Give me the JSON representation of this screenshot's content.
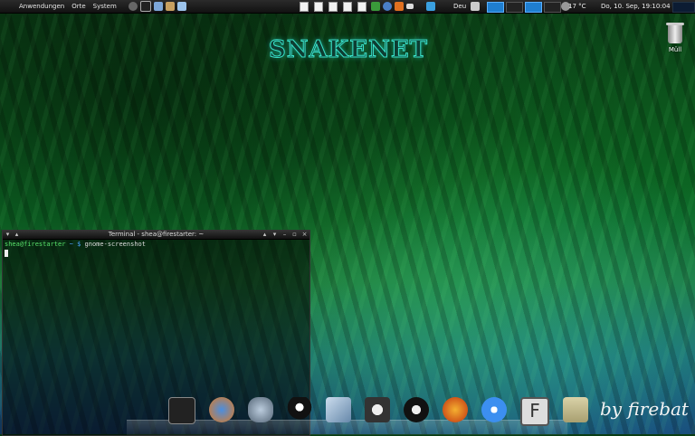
{
  "top_panel": {
    "menus": [
      "Anwendungen",
      "Orte",
      "System"
    ],
    "launchers": [
      "search-icon",
      "terminal-icon",
      "file-manager-icon",
      "tools-icon",
      "package-icon"
    ],
    "documents": [
      "document-icon",
      "document-icon",
      "document-icon",
      "document-icon",
      "document-icon"
    ],
    "tray": [
      "network-icon",
      "update-icon",
      "download-icon",
      "battery-icon"
    ],
    "keyboard_layout": "Deu",
    "weather": "17 °C",
    "clock": "Do, 10. Sep, 19:10:04",
    "active_workspace": 1
  },
  "desktop": {
    "title": "SNAKENET",
    "trash_label": "Müll",
    "signature": "by firebat"
  },
  "terminal": {
    "title": "Terminal - shea@firestarter: ~",
    "prompt_user": "shea@firestarter",
    "prompt_path": "~",
    "prompt_symbol": "$",
    "command": "gnome-screenshot"
  },
  "dock": {
    "items": [
      "terminal-app-icon",
      "thunderbird-icon",
      "pidgin-icon",
      "tux-icon",
      "inkscape-icon",
      "camera-icon",
      "steam-icon",
      "firefox-icon",
      "chat-icon",
      "filezilla-icon",
      "folder-icon"
    ]
  },
  "colors": {
    "accent": "#1f7ed0",
    "title_glow": "#39e0c8",
    "prompt_green": "#58e06a"
  }
}
